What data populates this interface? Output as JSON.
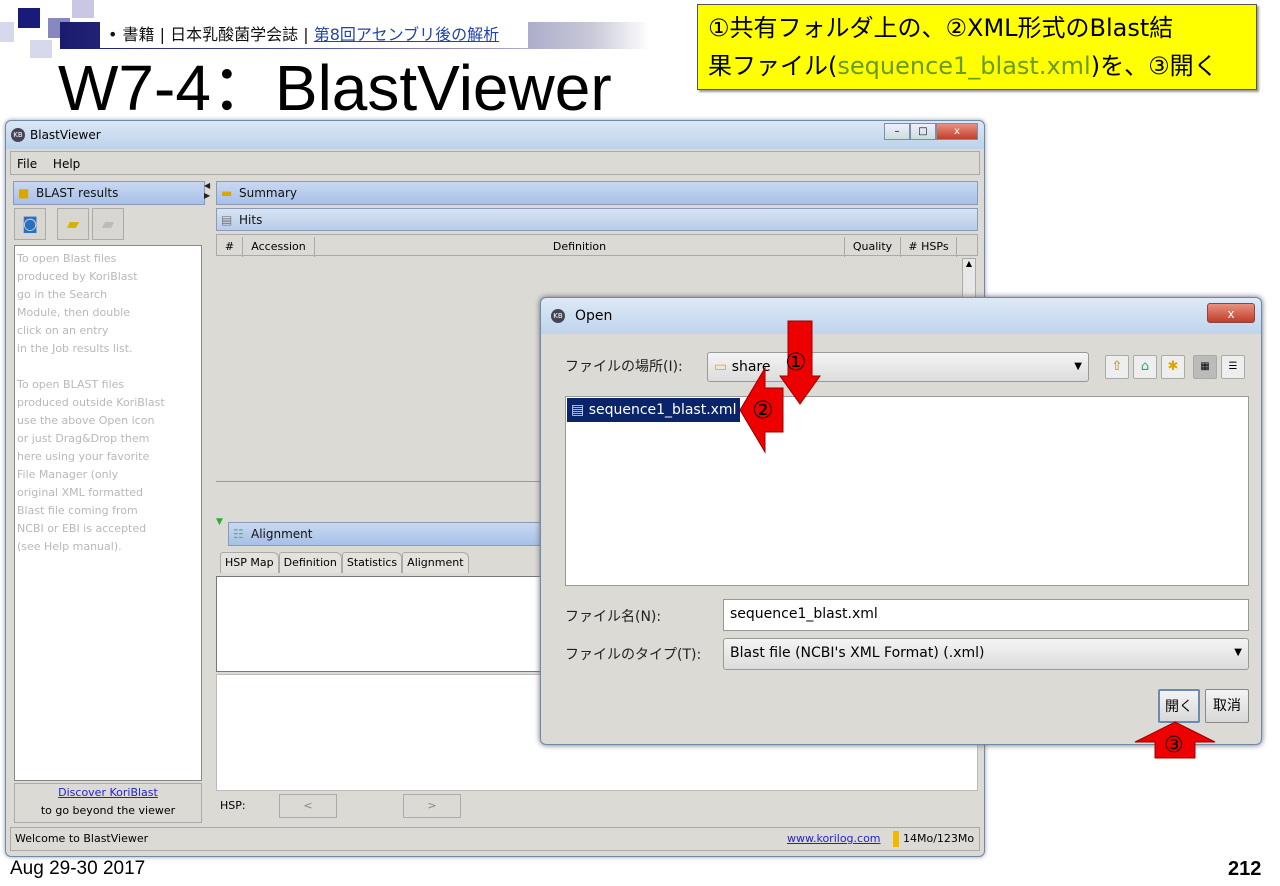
{
  "slide": {
    "breadcrumb": {
      "bullet": "•",
      "part1": "書籍",
      "sep": "|",
      "part2": "日本乳酸菌学会誌",
      "link": "第8回アセンブリ後の解析"
    },
    "title": "W7-4：BlastViewer",
    "callout": {
      "line1": "①共有フォルダ上の、②XML形式のBlast結",
      "line2_pre": "果ファイル(",
      "line2_file": "sequence1_blast.xml",
      "line2_post": ")を、③開く"
    },
    "footer_date": "Aug 29-30 2017",
    "page_number": "212",
    "annotations": [
      "①",
      "②",
      "③"
    ],
    "arrow_color": "#ee0000",
    "callout_color": "#ffff00"
  },
  "window": {
    "title": "BlastViewer",
    "menu": [
      "File",
      "Help"
    ],
    "left_panel": {
      "header": "BLAST results",
      "help_lines": [
        "To open Blast files",
        "produced by KoriBlast",
        "go in the Search",
        "Module, then double",
        "click on an entry",
        "in the Job results list.",
        "",
        "To open BLAST files",
        "produced outside KoriBlast",
        "use the above Open icon",
        "or just Drag&Drop them",
        "here using your favorite",
        "File Manager (only",
        "original XML formatted",
        "Blast file coming from",
        "NCBI or EBI is accepted",
        "(see Help manual)."
      ],
      "discover_link": "Discover KoriBlast",
      "discover_sub": "to go beyond the viewer"
    },
    "summary_label": "Summary",
    "hits_label": "Hits",
    "columns": [
      "#",
      "Accession",
      "Definition",
      "Quality",
      "# HSPs"
    ],
    "alignment_label": "Alignment",
    "tabs": [
      "HSP Map",
      "Definition",
      "Statistics",
      "Alignment"
    ],
    "hsp_label": "HSP:",
    "prev": "<",
    "next": ">",
    "status": "Welcome to BlastViewer",
    "website": "www.korilog.com",
    "memory": "14Mo/123Mo"
  },
  "dialog": {
    "title": "Open",
    "location_label": "ファイルの場所(I):",
    "location_value": "share",
    "files": [
      "sequence1_blast.xml"
    ],
    "filename_label": "ファイル名(N):",
    "filename_value": "sequence1_blast.xml",
    "filetype_label": "ファイルのタイプ(T):",
    "filetype_value": "Blast file (NCBI's XML Format) (.xml)",
    "open_button": "開く",
    "cancel_button": "取消"
  }
}
